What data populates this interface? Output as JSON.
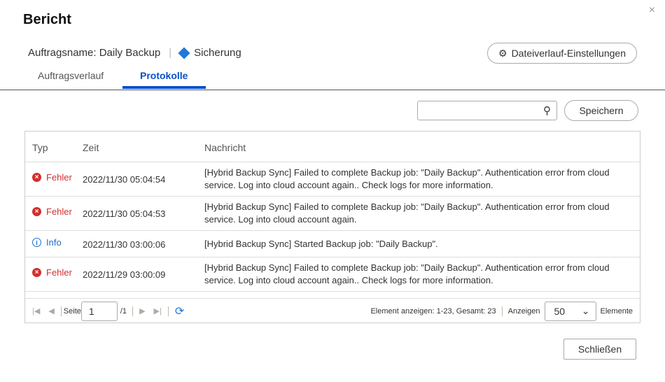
{
  "dialog": {
    "title": "Bericht",
    "close_icon": "×"
  },
  "job": {
    "label": "Auftragsname: Daily Backup",
    "type": "Sicherung"
  },
  "settings_button": "Dateiverlauf-Einstellungen",
  "tabs": [
    {
      "label": "Auftragsverlauf"
    },
    {
      "label": "Protokolle"
    }
  ],
  "search": {
    "value": "",
    "placeholder": ""
  },
  "save_button": "Speichern",
  "table": {
    "headers": [
      "Typ",
      "Zeit",
      "Nachricht"
    ],
    "rows": [
      {
        "type": "Fehler",
        "time": "2022/11/30 05:04:54",
        "message": "[Hybrid Backup Sync] Failed to complete Backup job: \"Daily Backup\". Authentication error from cloud service. Log into cloud account again.. Check logs for more information."
      },
      {
        "type": "Fehler",
        "time": "2022/11/30 05:04:53",
        "message": "[Hybrid Backup Sync] Failed to complete Backup job: \"Daily Backup\". Authentication error from cloud service. Log into cloud account again."
      },
      {
        "type": "Info",
        "time": "2022/11/30 03:00:06",
        "message": "[Hybrid Backup Sync] Started Backup job: \"Daily Backup\"."
      },
      {
        "type": "Fehler",
        "time": "2022/11/29 03:00:09",
        "message": "[Hybrid Backup Sync] Failed to complete Backup job: \"Daily Backup\". Authentication error from cloud service. Log into cloud account again.. Check logs for more information."
      }
    ]
  },
  "pager": {
    "page_label": "Seite",
    "page": "1",
    "total_pages": "/1",
    "summary": "Element anzeigen: 1-23, Gesamt: 23",
    "show_label": "Anzeigen",
    "per_page": "50",
    "items_label": "Elemente"
  },
  "close_button": "Schließen"
}
